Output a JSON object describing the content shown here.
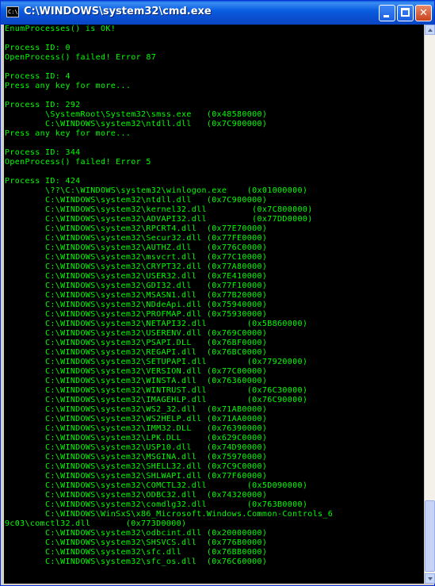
{
  "window": {
    "title": "C:\\WINDOWS\\system32\\cmd.exe",
    "icon_label": "C:\\",
    "buttons": {
      "minimize": "minimize",
      "maximize": "maximize",
      "close": "✕"
    }
  },
  "colors": {
    "console_bg": "#000000",
    "console_text": "#00ff00",
    "titlebar": "#0a5fd8"
  },
  "console": {
    "lines": [
      "EnumProcesses() is OK!",
      "",
      "Process ID: 0",
      "OpenProcess() failed! Error 87",
      "",
      "Process ID: 4",
      "Press any key for more...",
      "",
      "Process ID: 292",
      "        \\SystemRoot\\System32\\smss.exe   (0x48580000)",
      "        C:\\WINDOWS\\system32\\ntdll.dll   (0x7C900000)",
      "Press any key for more...",
      "",
      "Process ID: 344",
      "OpenProcess() failed! Error 5",
      "",
      "Process ID: 424",
      "        \\??\\C:\\WINDOWS\\system32\\winlogon.exe    (0x01000000)",
      "        C:\\WINDOWS\\system32\\ntdll.dll   (0x7C900000)",
      "        C:\\WINDOWS\\system32\\kernel32.dll         (0x7C800000)",
      "        C:\\WINDOWS\\system32\\ADVAPI32.dll         (0x77DD0000)",
      "        C:\\WINDOWS\\system32\\RPCRT4.dll  (0x77E70000)",
      "        C:\\WINDOWS\\system32\\Secur32.dll (0x77FE0000)",
      "        C:\\WINDOWS\\system32\\AUTHZ.dll   (0x776C0000)",
      "        C:\\WINDOWS\\system32\\msvcrt.dll  (0x77C10000)",
      "        C:\\WINDOWS\\system32\\CRYPT32.dll (0x77A80000)",
      "        C:\\WINDOWS\\system32\\USER32.dll  (0x7E410000)",
      "        C:\\WINDOWS\\system32\\GDI32.dll   (0x77F10000)",
      "        C:\\WINDOWS\\system32\\MSASN1.dll  (0x77B20000)",
      "        C:\\WINDOWS\\system32\\NDdeApi.dll (0x75940000)",
      "        C:\\WINDOWS\\system32\\PROFMAP.dll (0x75930000)",
      "        C:\\WINDOWS\\system32\\NETAPI32.dll        (0x5B860000)",
      "        C:\\WINDOWS\\system32\\USERENV.dll (0x769C0000)",
      "        C:\\WINDOWS\\system32\\PSAPI.DLL   (0x76BF0000)",
      "        C:\\WINDOWS\\system32\\REGAPI.dll  (0x76BC0000)",
      "        C:\\WINDOWS\\system32\\SETUPAPI.dll        (0x77920000)",
      "        C:\\WINDOWS\\system32\\VERSION.dll (0x77C00000)",
      "        C:\\WINDOWS\\system32\\WINSTA.dll  (0x76360000)",
      "        C:\\WINDOWS\\system32\\WINTRUST.dll        (0x76C30000)",
      "        C:\\WINDOWS\\system32\\IMAGEHLP.dll        (0x76C90000)",
      "        C:\\WINDOWS\\system32\\WS2_32.dll  (0x71AB0000)",
      "        C:\\WINDOWS\\system32\\WS2HELP.dll (0x71AA0000)",
      "        C:\\WINDOWS\\system32\\IMM32.DLL   (0x76390000)",
      "        C:\\WINDOWS\\system32\\LPK.DLL     (0x629C0000)",
      "        C:\\WINDOWS\\system32\\USP10.dll   (0x74D90000)",
      "        C:\\WINDOWS\\system32\\MSGINA.dll  (0x75970000)",
      "        C:\\WINDOWS\\system32\\SHELL32.dll (0x7C9C0000)",
      "        C:\\WINDOWS\\system32\\SHLWAPI.dll (0x77F60000)",
      "        C:\\WINDOWS\\system32\\COMCTL32.dll        (0x5D090000)",
      "        C:\\WINDOWS\\system32\\ODBC32.dll  (0x74320000)",
      "        C:\\WINDOWS\\system32\\comdlg32.dll        (0x763B0000)",
      "        C:\\WINDOWS\\WinSxS\\x86_Microsoft.Windows.Common-Controls_6",
      "9c03\\comctl32.dll       (0x773D0000)",
      "        C:\\WINDOWS\\system32\\odbcint.dll (0x20000000)",
      "        C:\\WINDOWS\\system32\\SHSVCS.dll  (0x776B0000)",
      "        C:\\WINDOWS\\system32\\sfc.dll     (0x76BB0000)",
      "        C:\\WINDOWS\\system32\\sfc_os.dll  (0x76C60000)"
    ]
  }
}
